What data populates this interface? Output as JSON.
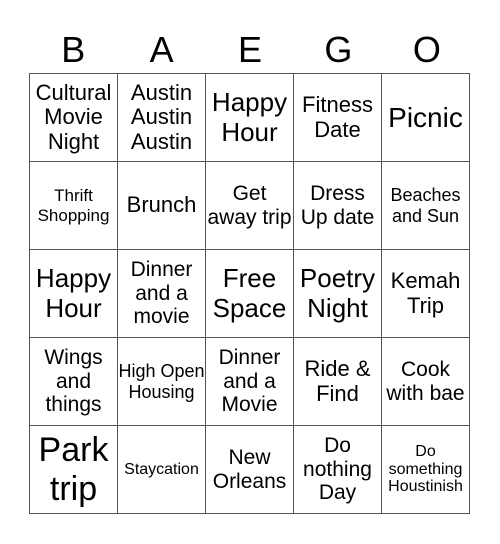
{
  "header": [
    "B",
    "A",
    "E",
    "G",
    "O"
  ],
  "cells": [
    [
      "Cultural Movie Night",
      "Austin Austin Austin",
      "Happy Hour",
      "Fitness Date",
      "Picnic"
    ],
    [
      "Thrift Shopping",
      "Brunch",
      "Get away trip",
      "Dress Up date",
      "Beaches and Sun"
    ],
    [
      "Happy Hour",
      "Dinner and a movie",
      "Free Space",
      "Poetry Night",
      "Kemah Trip"
    ],
    [
      "Wings and things",
      "High Open Housing",
      "Dinner and a Movie",
      "Ride & Find",
      "Cook with bae"
    ],
    [
      "Park trip",
      "Staycation",
      "New Orleans",
      "Do nothing Day",
      "Do something Houstinish"
    ]
  ]
}
